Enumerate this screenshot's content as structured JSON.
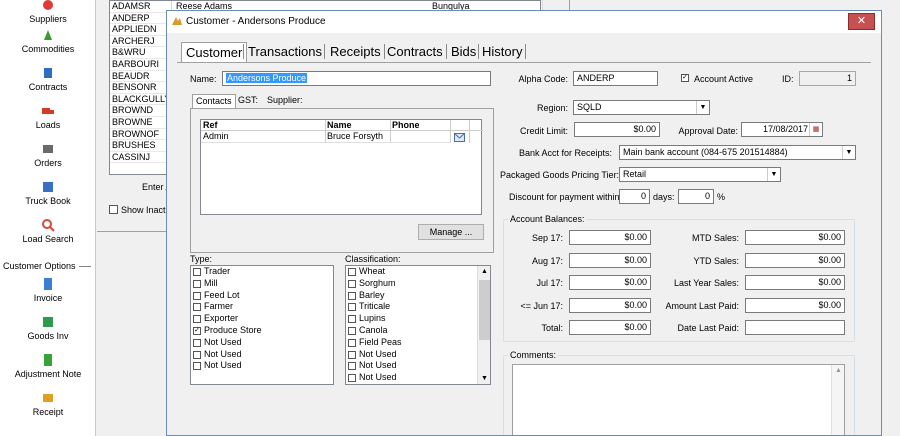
{
  "sidebar": {
    "items": [
      {
        "label": "Suppliers",
        "icon": "suppliers-icon",
        "color": "#e03a3a"
      },
      {
        "label": "Commodities",
        "icon": "commodities-icon",
        "color": "#3b9a2e"
      },
      {
        "label": "Contracts",
        "icon": "contracts-icon",
        "color": "#2f6fc1"
      },
      {
        "label": "Loads",
        "icon": "truck-icon",
        "color": "#d23a2a"
      },
      {
        "label": "Orders",
        "icon": "orders-icon",
        "color": "#6a6a6a"
      },
      {
        "label": "Truck Book",
        "icon": "truck-book-icon",
        "color": "#3a6fc4"
      },
      {
        "label": "Load Search",
        "icon": "load-search-icon",
        "color": "#d44a3a"
      }
    ],
    "section_header": "Customer Options",
    "options": [
      {
        "label": "Invoice",
        "icon": "invoice-icon",
        "color": "#3a7fd4"
      },
      {
        "label": "Goods Inv",
        "icon": "goods-inv-icon",
        "color": "#2f9a4e"
      },
      {
        "label": "Adjustment Note",
        "icon": "adjustment-note-icon",
        "color": "#3ba23a"
      },
      {
        "label": "Receipt",
        "icon": "receipt-icon",
        "color": "#e0a020"
      }
    ]
  },
  "background_window": {
    "rows": [
      {
        "code": "ADAMSR",
        "name": "Reese Adams",
        "place": "Bungulya"
      },
      {
        "code": "ANDERP",
        "name": "",
        "place": ""
      },
      {
        "code": "APPLIEDN",
        "name": "",
        "place": ""
      },
      {
        "code": "ARCHERJ",
        "name": "",
        "place": ""
      },
      {
        "code": "B&WRU",
        "name": "",
        "place": ""
      },
      {
        "code": "BARBOURI",
        "name": "",
        "place": ""
      },
      {
        "code": "BEAUDR",
        "name": "",
        "place": ""
      },
      {
        "code": "BENSONR",
        "name": "",
        "place": ""
      },
      {
        "code": "BLACKGULLY",
        "name": "",
        "place": ""
      },
      {
        "code": "BROWND",
        "name": "",
        "place": ""
      },
      {
        "code": "BROWNE",
        "name": "",
        "place": ""
      },
      {
        "code": "BROWNOF",
        "name": "",
        "place": ""
      },
      {
        "code": "BRUSHES",
        "name": "",
        "place": ""
      },
      {
        "code": "CASSINJ",
        "name": "",
        "place": ""
      }
    ],
    "enter_label": "Enter A",
    "show_inactive_label": "Show Inacti"
  },
  "dialog": {
    "title": "Customer - Andersons Produce",
    "close_label": "✕",
    "tabs": [
      "Customer",
      "Transactions",
      "Receipts",
      "Contracts",
      "Bids",
      "History"
    ],
    "name_label": "Name:",
    "name_value": "Andersons Produce",
    "subtabs": [
      "Contacts",
      "GST:",
      "Supplier:"
    ],
    "contacts": {
      "headers": [
        "Ref",
        "Name",
        "Phone"
      ],
      "rows": [
        {
          "ref": "Admin",
          "name": "Bruce Forsyth",
          "phone": ""
        }
      ],
      "manage_label": "Manage ..."
    },
    "type_label": "Type:",
    "types": [
      {
        "label": "Trader",
        "checked": false
      },
      {
        "label": "Mill",
        "checked": false
      },
      {
        "label": "Feed Lot",
        "checked": false
      },
      {
        "label": "Farmer",
        "checked": false
      },
      {
        "label": "Exporter",
        "checked": false
      },
      {
        "label": "Produce Store",
        "checked": true
      },
      {
        "label": "Not Used",
        "checked": false
      },
      {
        "label": "Not Used",
        "checked": false
      },
      {
        "label": "Not Used",
        "checked": false
      }
    ],
    "classification_label": "Classification:",
    "classifications": [
      {
        "label": "Wheat",
        "checked": false
      },
      {
        "label": "Sorghum",
        "checked": false
      },
      {
        "label": "Barley",
        "checked": false
      },
      {
        "label": "Triticale",
        "checked": false
      },
      {
        "label": "Lupins",
        "checked": false
      },
      {
        "label": "Canola",
        "checked": false
      },
      {
        "label": "Field Peas",
        "checked": false
      },
      {
        "label": "Not Used",
        "checked": false
      },
      {
        "label": "Not Used",
        "checked": false
      },
      {
        "label": "Not Used",
        "checked": false
      }
    ],
    "alpha_code_label": "Alpha Code:",
    "alpha_code_value": "ANDERP",
    "account_active_label": "Account Active",
    "account_active": true,
    "id_label": "ID:",
    "id_value": "1",
    "region_label": "Region:",
    "region_value": "SQLD",
    "credit_limit_label": "Credit Limit:",
    "credit_limit_value": "$0.00",
    "approval_date_label": "Approval Date:",
    "approval_date_value": "17/08/2017",
    "bank_acct_label": "Bank Acct for Receipts:",
    "bank_acct_value": "Main bank account (084-675 201514884)",
    "pricing_tier_label": "Packaged Goods Pricing Tier:",
    "pricing_tier_value": "Retail",
    "discount_label": "Discount for payment within",
    "discount_days_value": "0",
    "days_label": "days:",
    "discount_pct_value": "0",
    "pct_label": "%",
    "balances_label": "Account Balances:",
    "balances_left": [
      {
        "label": "Sep 17:",
        "value": "$0.00"
      },
      {
        "label": "Aug 17:",
        "value": "$0.00"
      },
      {
        "label": "Jul 17:",
        "value": "$0.00"
      },
      {
        "label": "<= Jun 17:",
        "value": "$0.00"
      },
      {
        "label": "Total:",
        "value": "$0.00"
      }
    ],
    "balances_right": [
      {
        "label": "MTD Sales:",
        "value": "$0.00"
      },
      {
        "label": "YTD Sales:",
        "value": "$0.00"
      },
      {
        "label": "Last Year Sales:",
        "value": "$0.00"
      },
      {
        "label": "Amount Last Paid:",
        "value": "$0.00"
      },
      {
        "label": "Date Last Paid:",
        "value": ""
      }
    ],
    "comments_label": "Comments:"
  }
}
